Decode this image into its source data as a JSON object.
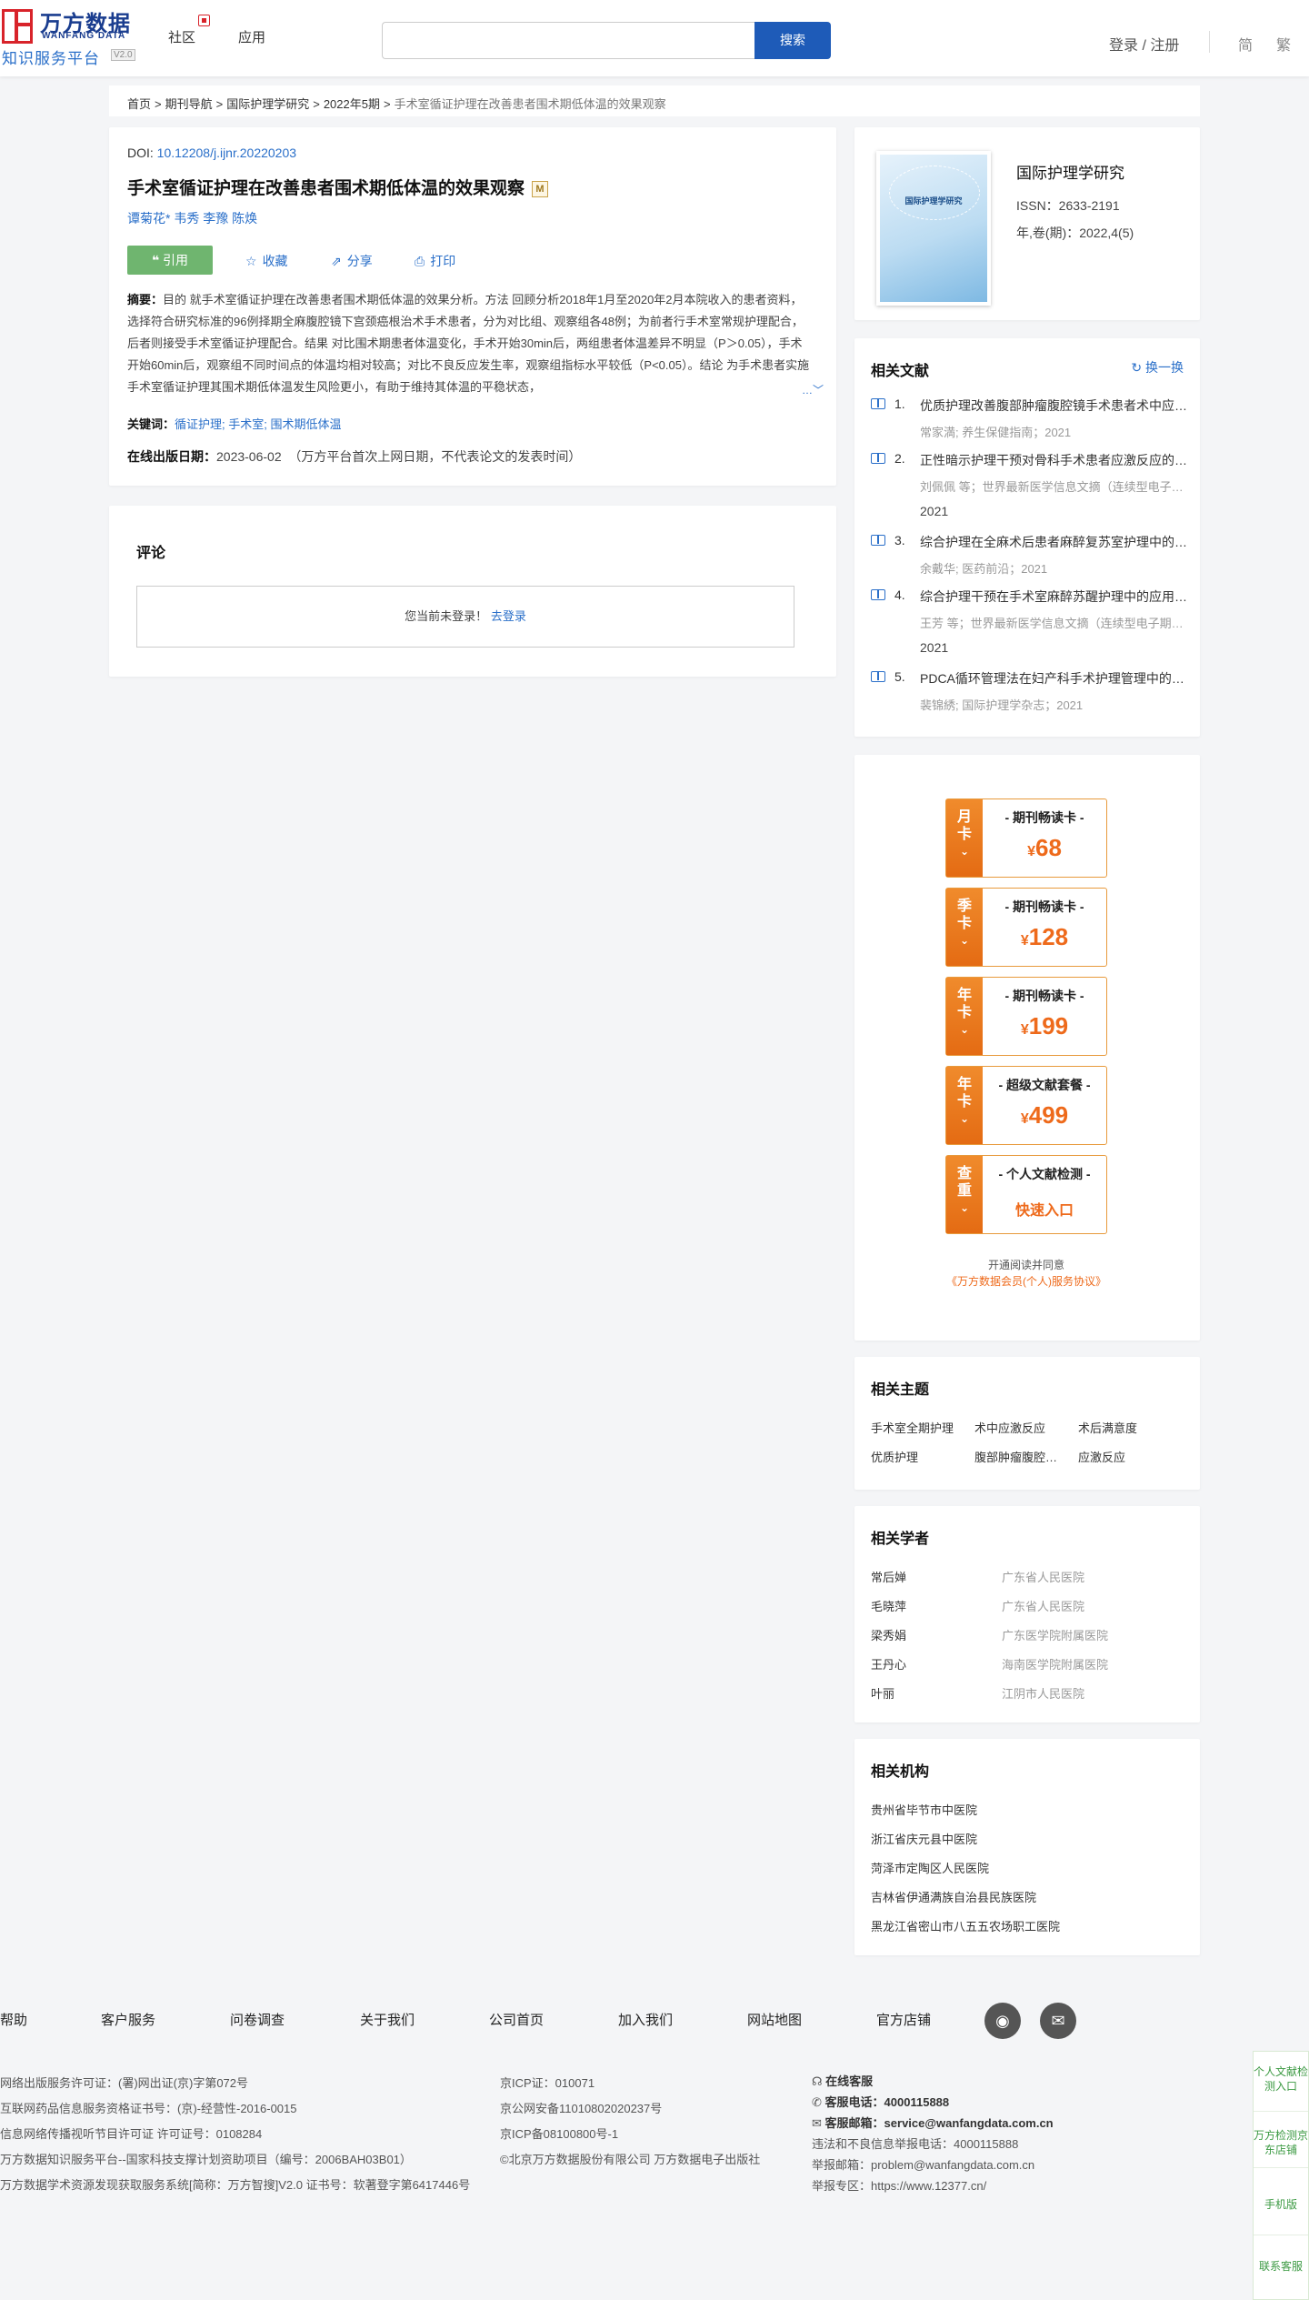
{
  "header": {
    "logo_cn": "万方数据",
    "logo_en": "WANFANG DATA",
    "platform": "知识服务平台",
    "version": "V2.0",
    "nav": [
      "社区",
      "应用"
    ],
    "search_placeholder": "",
    "search_button": "搜索",
    "login": "登录 / 注册",
    "lang_simplified": "简",
    "lang_traditional": "繁"
  },
  "breadcrumb": {
    "items": [
      "首页",
      "期刊导航",
      "国际护理学研究",
      "2022年5期"
    ],
    "sep": ">",
    "current": "手术室循证护理在改善患者围术期低体温的效果观察"
  },
  "article": {
    "doi_label": "DOI:",
    "doi": "10.12208/j.ijnr.20220203",
    "title": "手术室循证护理在改善患者围术期低体温的效果观察",
    "title_badge": "M",
    "authors": [
      "谭菊花*",
      "韦秀",
      "李豫",
      "陈焕"
    ],
    "cite": "引用",
    "favorite": "收藏",
    "share": "分享",
    "print": "打印",
    "abstract_label": "摘要：",
    "abstract": "目的 就手术室循证护理在改善患者围术期低体温的效果分析。方法 回顾分析2018年1月至2020年2月本院收入的患者资料，选择符合研究标准的96例择期全麻腹腔镜下宫颈癌根治术手术患者，分为对比组、观察组各48例；为前者行手术室常规护理配合，后者则接受手术室循证护理配合。结果 对比围术期患者体温变化，手术开始30min后，两组患者体温差异不明显（P＞0.05），手术开始60min后，观察组不同时间点的体温均相对较高；对比不良反应发生率，观察组指标水平较低（P<0.05）。结论 为手术患者实施手术室循证护理其围术期低体温发生风险更小，有助于维持其体温的平稳状态，",
    "more": "…",
    "keywords_label": "关键词：",
    "keywords": [
      "循证护理",
      "手术室",
      "围术期低体温"
    ],
    "keywords_sep": ";",
    "pubdate_label": "在线出版日期：",
    "pubdate": "2023-06-02",
    "pubdate_note": "（万方平台首次上网日期，不代表论文的发表时间）"
  },
  "comments": {
    "title": "评论",
    "prompt": "您当前未登录！",
    "login_link": "去登录"
  },
  "journal": {
    "cover_title": "国际护理学研究",
    "name": "国际护理学研究",
    "issn": "ISSN：2633-2191",
    "volume": "年,卷(期)：2022,4(5)"
  },
  "related_docs": {
    "title": "相关文献",
    "refresh": "换一换",
    "items": [
      {
        "num": "1.",
        "title": "优质护理改善腹部肿瘤腹腔镜手术患者术中应激反应的效果分析",
        "sub": "常家満; 养生保健指南；2021",
        "year": ""
      },
      {
        "num": "2.",
        "title": "正性暗示护理干预对骨科手术患者应激反应的影响",
        "sub": "刘佩佩 等；世界最新医学信息文摘（连续型电子期刊）；",
        "year": "2021"
      },
      {
        "num": "3.",
        "title": "综合护理在全麻术后患者麻醉复苏室护理中的效果",
        "sub": "余戴华; 医药前沿；2021",
        "year": ""
      },
      {
        "num": "4.",
        "title": "综合护理干预在手术室麻醉苏醒护理中的应用效果",
        "sub": "王芳 等；世界最新医学信息文摘（连续型电子期刊）；",
        "year": "2021"
      },
      {
        "num": "5.",
        "title": "PDCA循环管理法在妇产科手术护理管理中的应用",
        "sub": "裴锦綉; 国际护理学杂志；2021",
        "year": ""
      }
    ]
  },
  "promo": {
    "cards": [
      {
        "tab": [
          "月",
          "卡"
        ],
        "head": "- 期刊畅读卡 -",
        "currency": "¥",
        "price": "68"
      },
      {
        "tab": [
          "季",
          "卡"
        ],
        "head": "- 期刊畅读卡 -",
        "currency": "¥",
        "price": "128"
      },
      {
        "tab": [
          "年",
          "卡"
        ],
        "head": "- 期刊畅读卡 -",
        "currency": "¥",
        "price": "199"
      },
      {
        "tab": [
          "年",
          "卡"
        ],
        "head": "- 超级文献套餐 -",
        "currency": "¥",
        "price": "499"
      },
      {
        "tab": [
          "查",
          "重"
        ],
        "head": "- 个人文献检测 -",
        "currency": "",
        "price": "快速入口"
      }
    ],
    "agree_text": "开通阅读并同意",
    "agree_link": "《万方数据会员(个人)服务协议》"
  },
  "topics": {
    "title": "相关主题",
    "items": [
      "手术室全期护理",
      "术中应激反应",
      "术后满意度",
      "优质护理",
      "腹部肿瘤腹腔镜手术",
      "应激反应"
    ]
  },
  "scholars": {
    "title": "相关学者",
    "items": [
      {
        "name": "常后婵",
        "org": "广东省人民医院"
      },
      {
        "name": "毛晓萍",
        "org": "广东省人民医院"
      },
      {
        "name": "梁秀娟",
        "org": "广东医学院附属医院"
      },
      {
        "name": "王丹心",
        "org": "海南医学院附属医院"
      },
      {
        "name": "叶丽",
        "org": "江阴市人民医院"
      }
    ]
  },
  "institutions": {
    "title": "相关机构",
    "items": [
      "贵州省毕节市中医院",
      "浙江省庆元县中医院",
      "菏泽市定陶区人民医院",
      "吉林省伊通满族自治县民族医院",
      "黑龙江省密山市八五五农场职工医院"
    ]
  },
  "footer": {
    "links": [
      "帮助",
      "客户服务",
      "问卷调查",
      "关于我们",
      "公司首页",
      "加入我们",
      "网站地图",
      "官方店铺"
    ],
    "col1": [
      "网络出版服务许可证：(署)网出证(京)字第072号",
      "互联网药品信息服务资格证书号：(京)-经营性-2016-0015",
      "信息网络传播视听节目许可证 许可证号：0108284",
      "万方数据知识服务平台--国家科技支撑计划资助项目（编号：2006BAH03B01）",
      "万方数据学术资源发现获取服务系统[简称：万方智搜]V2.0 证书号：软著登字第6417446号"
    ],
    "col2": [
      "京ICP证：010071",
      "京公网安备11010802020237号",
      "京ICP备08100800号-1",
      "©北京万方数据股份有限公司 万方数据电子出版社"
    ],
    "online_service": "在线客服",
    "phone_label": "客服电话：",
    "phone": "4000115888",
    "email_label": "客服邮箱：",
    "email": "service@wanfangdata.com.cn",
    "report_phone": "违法和不良信息举报电话：4000115888",
    "report_email": "举报邮箱：problem@wanfangdata.com.cn",
    "report_zone": "举报专区：https://www.12377.cn/"
  },
  "side_float": [
    "个人文献检测入口",
    "万方检测京东店铺",
    "手机版",
    "联系客服"
  ]
}
